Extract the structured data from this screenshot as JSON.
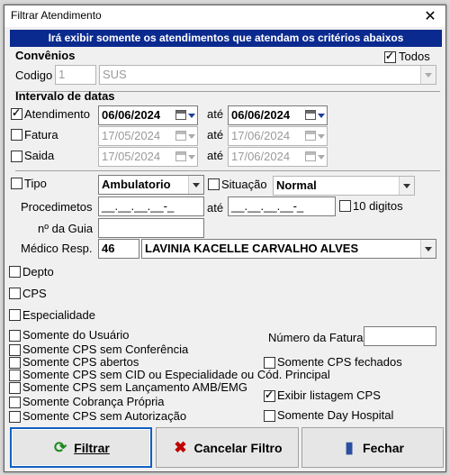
{
  "dialog": {
    "title": "Filtrar Atendimento",
    "banner": "Irá exibir somente os atendimentos que atendam os critérios abaixos"
  },
  "convenios": {
    "section": "Convênios",
    "todos_label": "Todos",
    "todos_checked": true,
    "codigo_label": "Codigo",
    "codigo_value": "1",
    "name_value": "SUS"
  },
  "intervalo": {
    "section": "Intervalo de datas",
    "ate": "até",
    "rows": [
      {
        "label": "Atendimento",
        "checked": true,
        "from": "06/06/2024",
        "to": "06/06/2024"
      },
      {
        "label": "Fatura",
        "checked": false,
        "from": "17/05/2024",
        "to": "17/06/2024"
      },
      {
        "label": "Saida",
        "checked": false,
        "from": "17/05/2024",
        "to": "17/06/2024"
      }
    ]
  },
  "filters": {
    "tipo_label": "Tipo",
    "tipo_value": "Ambulatorio",
    "situacao_label": "Situação",
    "situacao_value": "Normal",
    "procedimentos_label": "Procedimetos",
    "proc_from": "__.__.__.__-_",
    "ate": "até",
    "proc_to": "__.__.__.__-_",
    "dez_digitos_label": "10 digitos",
    "guia_label": "nº da Guia",
    "guia_value": "",
    "medico_label": "Médico Resp.",
    "medico_code": "46",
    "medico_name": "LAVINIA KACELLE CARVALHO ALVES"
  },
  "checks": {
    "depto": "Depto",
    "cps": "CPS",
    "especialidade": "Especialidade",
    "somente_usuario": "Somente do Usuário",
    "sem_conferencia": "Somente CPS sem Conferência",
    "abertos": "Somente CPS abertos",
    "sem_cid": "Somente CPS sem CID ou Especialidade ou Cód. Principal",
    "sem_lancamento": "Somente CPS sem Lançamento AMB/EMG",
    "cobranca_propria": "Somente Cobrança Própria",
    "sem_autorizacao": "Somente CPS sem Autorização",
    "numero_fatura_label": "Número da Fatura",
    "numero_fatura_value": "",
    "fechados": "Somente CPS fechados",
    "exibir_listagem": "Exibir listagem CPS",
    "exibir_listagem_checked": true,
    "day_hospital": "Somente Day Hospital"
  },
  "buttons": {
    "filtrar": "Filtrar",
    "cancelar": "Cancelar Filtro",
    "fechar": "Fechar"
  },
  "colors": {
    "banner_bg": "#0b2a8f",
    "focus_border": "#1060c0",
    "cancel_icon": "#c00000",
    "refresh_icon": "#1a8a1a"
  }
}
